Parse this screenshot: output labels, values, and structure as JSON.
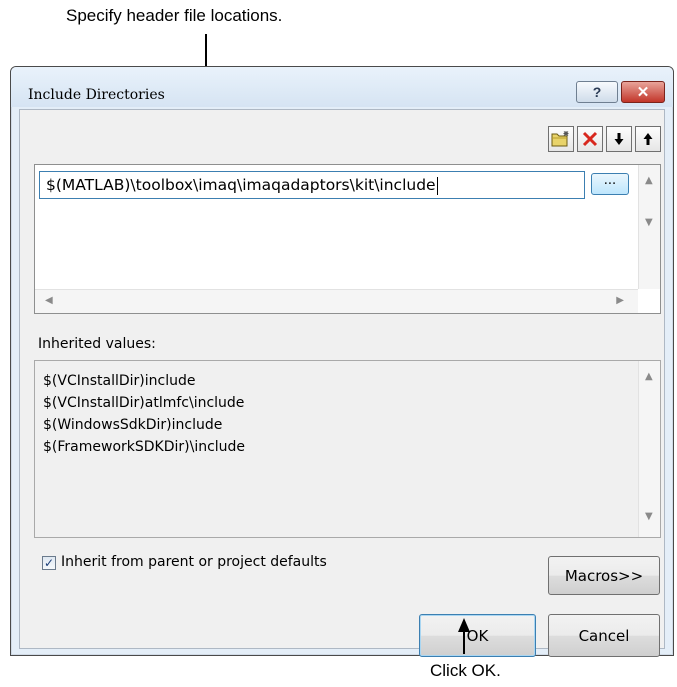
{
  "annotations": {
    "top": "Specify header file locations.",
    "bottom": "Click OK."
  },
  "window": {
    "title": "Include Directories",
    "help_label": "?",
    "close_label": "x"
  },
  "toolbar": {
    "new_line_icon": "folder-new-icon",
    "delete_icon": "delete-x-icon",
    "move_down_icon": "arrow-down-icon",
    "move_up_icon": "arrow-up-icon"
  },
  "directories": {
    "entry_value": "$(MATLAB)\\toolbox\\imaq\\imaqadaptors\\kit\\include",
    "browse_label": "..."
  },
  "inherited": {
    "label": "Inherited values:",
    "items": [
      "$(VCInstallDir)include",
      "$(VCInstallDir)atlmfc\\include",
      "$(WindowsSdkDir)include",
      "$(FrameworkSDKDir)\\include"
    ]
  },
  "inherit_checkbox": {
    "label": "Inherit from parent or project defaults",
    "checked": true,
    "mark": "✓"
  },
  "buttons": {
    "macros": "Macros>>",
    "ok": "OK",
    "cancel": "Cancel"
  },
  "colors": {
    "close_button": "#c2362a",
    "focus_border": "#3c7fb1",
    "client_bg": "#f0f0f0"
  }
}
